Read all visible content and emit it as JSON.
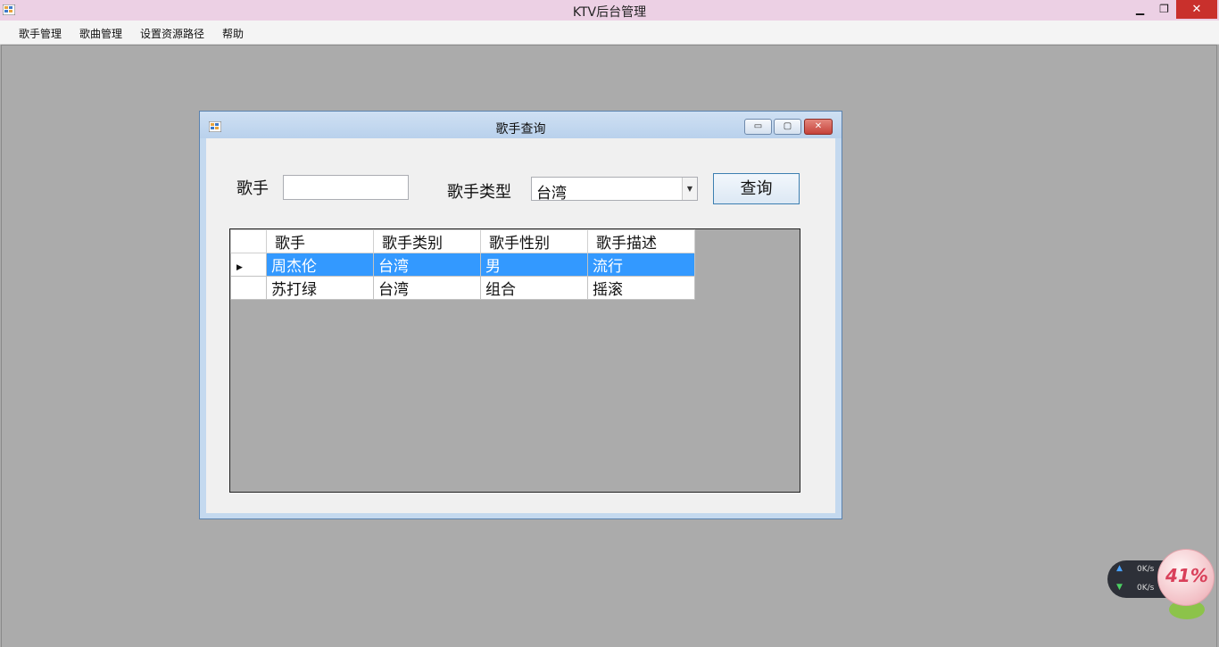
{
  "main_window": {
    "title": "KTV后台管理",
    "min_glyph": "▁",
    "max_glyph": "❐",
    "close_glyph": "✕"
  },
  "menu": {
    "items": [
      "歌手管理",
      "歌曲管理",
      "设置资源路径",
      "帮助"
    ]
  },
  "child_window": {
    "title": "歌手查询",
    "min_glyph": "▭",
    "max_glyph": "▢",
    "close_glyph": "✕"
  },
  "form": {
    "singer_label": "歌手",
    "singer_value": "",
    "type_label": "歌手类型",
    "type_value": "台湾",
    "query_button": "查询"
  },
  "grid": {
    "columns": [
      "歌手",
      "歌手类别",
      "歌手性别",
      "歌手描述"
    ],
    "rows": [
      [
        "周杰伦",
        "台湾",
        "男",
        "流行"
      ],
      [
        "苏打绿",
        "台湾",
        "组合",
        "摇滚"
      ]
    ],
    "selected_row": 0
  },
  "net_widget": {
    "up_speed": "0K/s",
    "down_speed": "0K/s",
    "percent": "41%"
  },
  "colors": {
    "selection": "#3399ff",
    "desktop": "#ababab",
    "title_bar": "#ecd0e4"
  }
}
